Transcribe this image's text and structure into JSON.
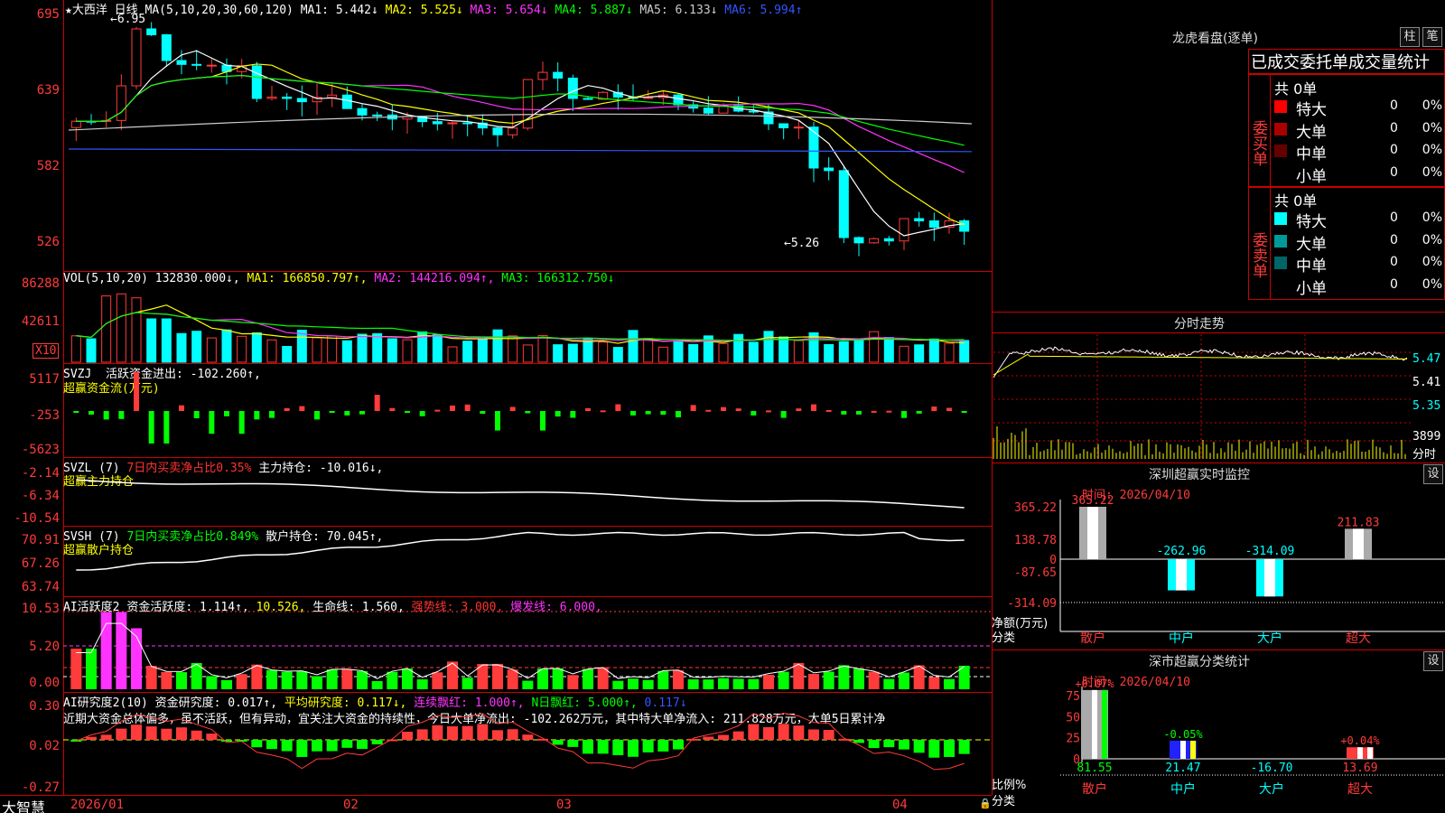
{
  "main": {
    "title": "★大西洋",
    "period": "日线",
    "ma_label": "MA(5,10,20,30,60,120)",
    "ma": [
      {
        "label": "MA1:",
        "value": "5.442↓",
        "color": "#ffffff"
      },
      {
        "label": "MA2:",
        "value": "5.525↓",
        "color": "#ffff00"
      },
      {
        "label": "MA3:",
        "value": "5.654↓",
        "color": "#ff33ff"
      },
      {
        "label": "MA4:",
        "value": "5.887↓",
        "color": "#00ff00"
      },
      {
        "label": "MA5:",
        "value": "6.133↓",
        "color": "#cccccc"
      },
      {
        "label": "MA6:",
        "value": "5.994↑",
        "color": "#3355ff"
      }
    ],
    "yticks": [
      "695",
      "639",
      "582",
      "526"
    ],
    "high_label": "6.95",
    "low_label": "5.26"
  },
  "vol": {
    "header": "VOL(5,10,20)",
    "value": "132830.000↓,",
    "ma": [
      {
        "label": "MA1:",
        "value": "166850.797↑,",
        "color": "#ffff00"
      },
      {
        "label": "MA2:",
        "value": "144216.094↑,",
        "color": "#ff33ff"
      },
      {
        "label": "MA3:",
        "value": "166312.750↓",
        "color": "#00ff00"
      }
    ],
    "yticks": [
      "86288",
      "42611"
    ],
    "unit": "X10"
  },
  "svzj": {
    "header": "SVZJ",
    "text": "活跃资金进出: -102.260↑,",
    "sub": "超赢资金流(万元)",
    "yticks": [
      "5117",
      "-253",
      "-5623"
    ]
  },
  "svzl": {
    "header": "SVZL (7)",
    "text1": "7日内买卖净占比0.35%",
    "text2": "主力持仓: -10.016↓,",
    "sub": "超赢主力持仓",
    "yticks": [
      "-2.14",
      "-6.34",
      "-10.54"
    ]
  },
  "svsh": {
    "header": "SVSH (7)",
    "text1": "7日内买卖净占比0.849%",
    "text2": "散户持仓: 70.045↑,",
    "sub": "超赢散户持仓",
    "yticks": [
      "70.91",
      "67.26",
      "63.74"
    ]
  },
  "ai_act": {
    "header": "AI活跃度2",
    "items": [
      {
        "text": "资金活跃度: 1.114↑,",
        "color": "#ffffff"
      },
      {
        "text": "10.526,",
        "color": "#ffff00"
      },
      {
        "text": "生命线: 1.560,",
        "color": "#ffffff"
      },
      {
        "text": "强势线: 3.000,",
        "color": "#ff3333"
      },
      {
        "text": "爆发线: 6.000,",
        "color": "#ff33ff"
      }
    ],
    "yticks": [
      "10.53",
      "5.20",
      "0.00"
    ]
  },
  "ai_res": {
    "header": "AI研究度2(10)",
    "items": [
      {
        "text": "资金研究度: 0.017↑,",
        "color": "#ffffff"
      },
      {
        "text": "平均研究度: 0.117↓,",
        "color": "#ffff00"
      },
      {
        "text": "连续飘红: 1.000↑,",
        "color": "#ff33ff"
      },
      {
        "text": "N日飘红: 5.000↑,",
        "color": "#00ff00"
      },
      {
        "text": "0.117↓",
        "color": "#3355ff"
      }
    ],
    "comment": "近期大资金总体偏多，虽不活跃，但有异动，宜关注大资金的持续性，今日大单净流出: -102.262万元，其中特大单净流入: 211.828万元，大单5日累计净",
    "yticks": [
      "0.30",
      "0.02",
      "-0.27"
    ]
  },
  "xaxis": {
    "brand": "大智慧",
    "labels": [
      "2026/01",
      "02",
      "03",
      "04"
    ]
  },
  "right": {
    "lhkp_title": "龙虎看盘(逐单)",
    "btn1": "柱",
    "btn2": "笔",
    "stats_title": "已成交委托单成交量统计",
    "buy": {
      "side": "委买单",
      "total": "共 0单",
      "rows": [
        {
          "name": "特大",
          "count": "0",
          "pct": "0%",
          "color": "#ff0000"
        },
        {
          "name": "大单",
          "count": "0",
          "pct": "0%",
          "color": "#aa0000"
        },
        {
          "name": "中单",
          "count": "0",
          "pct": "0%",
          "color": "#660000"
        },
        {
          "name": "小单",
          "count": "0",
          "pct": "0%",
          "color": "#000000"
        }
      ]
    },
    "sell": {
      "side": "委卖单",
      "total": "共 0单",
      "rows": [
        {
          "name": "特大",
          "count": "0",
          "pct": "0%",
          "color": "#00ffff"
        },
        {
          "name": "大单",
          "count": "0",
          "pct": "0%",
          "color": "#009999"
        },
        {
          "name": "中单",
          "count": "0",
          "pct": "0%",
          "color": "#006666"
        },
        {
          "name": "小单",
          "count": "0",
          "pct": "0%",
          "color": "#000000"
        }
      ]
    },
    "fs": {
      "title": "分时走势",
      "yticks": [
        "5.47",
        "5.41",
        "5.35"
      ],
      "vol": "3899",
      "unit": "分时"
    },
    "sz_monitor": {
      "title": "深圳超赢实时监控",
      "btn": "设",
      "date": "时间: 2026/04/10",
      "yticks": [
        "365.22",
        "138.78",
        "0",
        "-87.65",
        "-314.09"
      ],
      "ylabel": "净额(万元)",
      "xlabel": "分类",
      "cats": [
        "散户",
        "中户",
        "大户",
        "超大"
      ],
      "values": [
        365.22,
        -262.96,
        -314.09,
        211.83
      ],
      "labels": [
        "365.22",
        "-262.96",
        "-314.09",
        "211.83"
      ]
    },
    "sz_class": {
      "title": "深市超赢分类统计",
      "btn": "设",
      "date": "时间: 2026/04/10",
      "yticks": [
        "75",
        "50",
        "25",
        "0"
      ],
      "ylabel": "比例%",
      "xlabel": "分类",
      "cats": [
        "散户",
        "中户",
        "大户",
        "超大"
      ],
      "values": [
        81.55,
        21.47,
        -16.7,
        13.69
      ],
      "values_text": [
        "81.55",
        "21.47",
        "-16.70",
        "13.69"
      ],
      "changes": [
        "+0.07%",
        "-0.05%",
        "",
        "+0.04%"
      ]
    }
  }
}
